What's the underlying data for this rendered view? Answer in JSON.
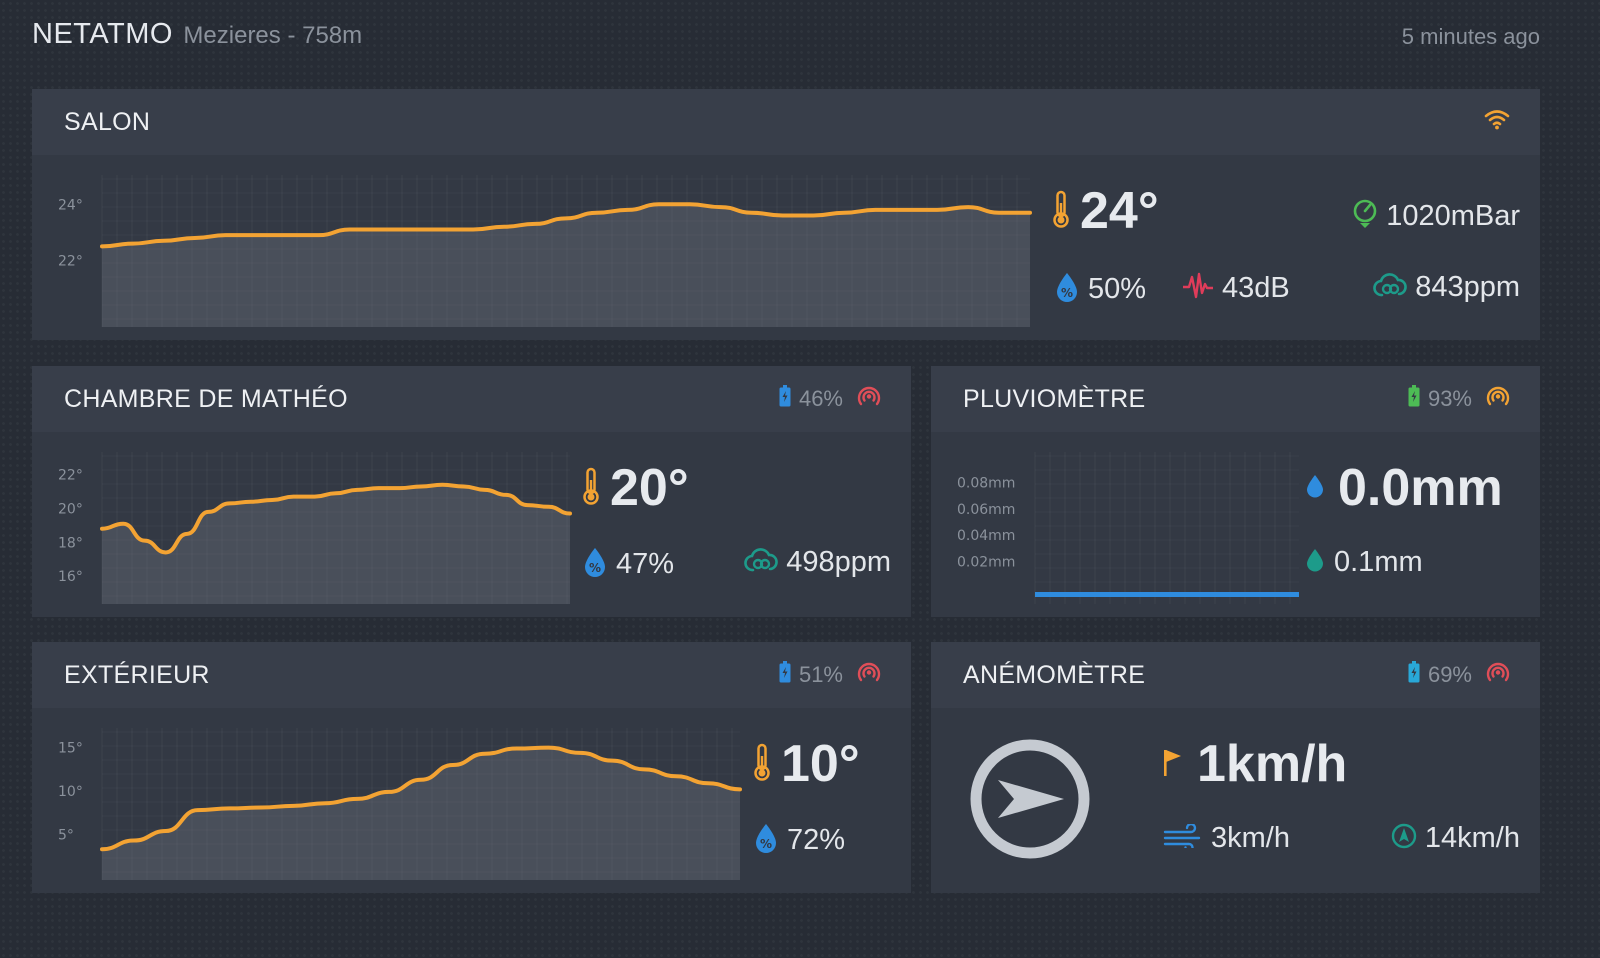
{
  "header": {
    "brand": "NETATMO",
    "location": "Mezieres - 758m",
    "updated": "5 minutes ago"
  },
  "colors": {
    "background": "#272c35",
    "card": "#333944",
    "card_header": "#383e4a",
    "accent_orange": "#f3a333",
    "blue": "#2f8cde",
    "teal": "#1d9b8a",
    "red": "#e04e58",
    "green": "#4dbb55"
  },
  "salon": {
    "title": "SALON",
    "signal_icon": "wifi-icon",
    "temperature": "24°",
    "pressure": "1020mBar",
    "humidity": "50%",
    "noise": "43dB",
    "co2": "843ppm"
  },
  "chambre": {
    "title": "CHAMBRE DE MATHÉO",
    "battery": "46%",
    "temperature": "20°",
    "humidity": "47%",
    "co2": "498ppm"
  },
  "pluviometre": {
    "title": "PLUVIOMÈTRE",
    "battery": "93%",
    "rain_now": "0.0mm",
    "rain_total": "0.1mm"
  },
  "exterieur": {
    "title": "EXTÉRIEUR",
    "battery": "51%",
    "temperature": "10°",
    "humidity": "72%"
  },
  "anemometre": {
    "title": "ANÉMOMÈTRE",
    "battery": "69%",
    "wind_speed": "1km/h",
    "wind_avg": "3km/h",
    "gust": "14km/h"
  },
  "chart_data": [
    {
      "id": "salon",
      "type": "area",
      "y_ticks": [
        "24°",
        "22°"
      ],
      "y_tick_values": [
        24,
        22
      ],
      "ylim": [
        20.2,
        24.9
      ],
      "values": [
        22.5,
        22.6,
        22.7,
        22.8,
        22.9,
        22.9,
        22.9,
        22.9,
        23.1,
        23.1,
        23.1,
        23.1,
        23.1,
        23.2,
        23.3,
        23.5,
        23.7,
        23.8,
        24.0,
        24.0,
        23.9,
        23.7,
        23.6,
        23.6,
        23.7,
        23.8,
        23.8,
        23.8,
        23.9,
        23.7,
        23.7
      ],
      "color": "#f3a333"
    },
    {
      "id": "chambre",
      "type": "area",
      "y_ticks": [
        "22°",
        "20°",
        "18°",
        "16°"
      ],
      "y_tick_values": [
        22,
        20,
        18,
        16
      ],
      "ylim": [
        15.3,
        23.1
      ],
      "values": [
        18.8,
        19.1,
        18.1,
        17.4,
        18.5,
        19.8,
        20.3,
        20.4,
        20.5,
        20.7,
        20.7,
        20.9,
        21.1,
        21.2,
        21.2,
        21.3,
        21.4,
        21.3,
        21.1,
        20.8,
        20.2,
        20.1,
        19.7
      ],
      "color": "#f3a333"
    },
    {
      "id": "pluviometre",
      "type": "area",
      "y_ticks": [
        "0.08mm",
        "0.06mm",
        "0.04mm",
        "0.02mm"
      ],
      "y_tick_values": [
        0.08,
        0.06,
        0.04,
        0.02
      ],
      "ylim": [
        0,
        0.1
      ],
      "values": [
        0,
        0,
        0,
        0,
        0,
        0,
        0,
        0,
        0,
        0
      ],
      "color": "#2f8cde"
    },
    {
      "id": "exterieur",
      "type": "area",
      "y_ticks": [
        "15°",
        "10°",
        "5°"
      ],
      "y_tick_values": [
        15,
        10,
        5
      ],
      "ylim": [
        1.6,
        16.8
      ],
      "values": [
        3.3,
        4.3,
        5.4,
        7.8,
        8.0,
        8.1,
        8.3,
        8.6,
        9.1,
        9.9,
        11.3,
        13.0,
        14.3,
        14.9,
        15.0,
        14.4,
        13.5,
        12.5,
        11.7,
        10.9,
        10.2
      ],
      "color": "#f3a333"
    }
  ]
}
